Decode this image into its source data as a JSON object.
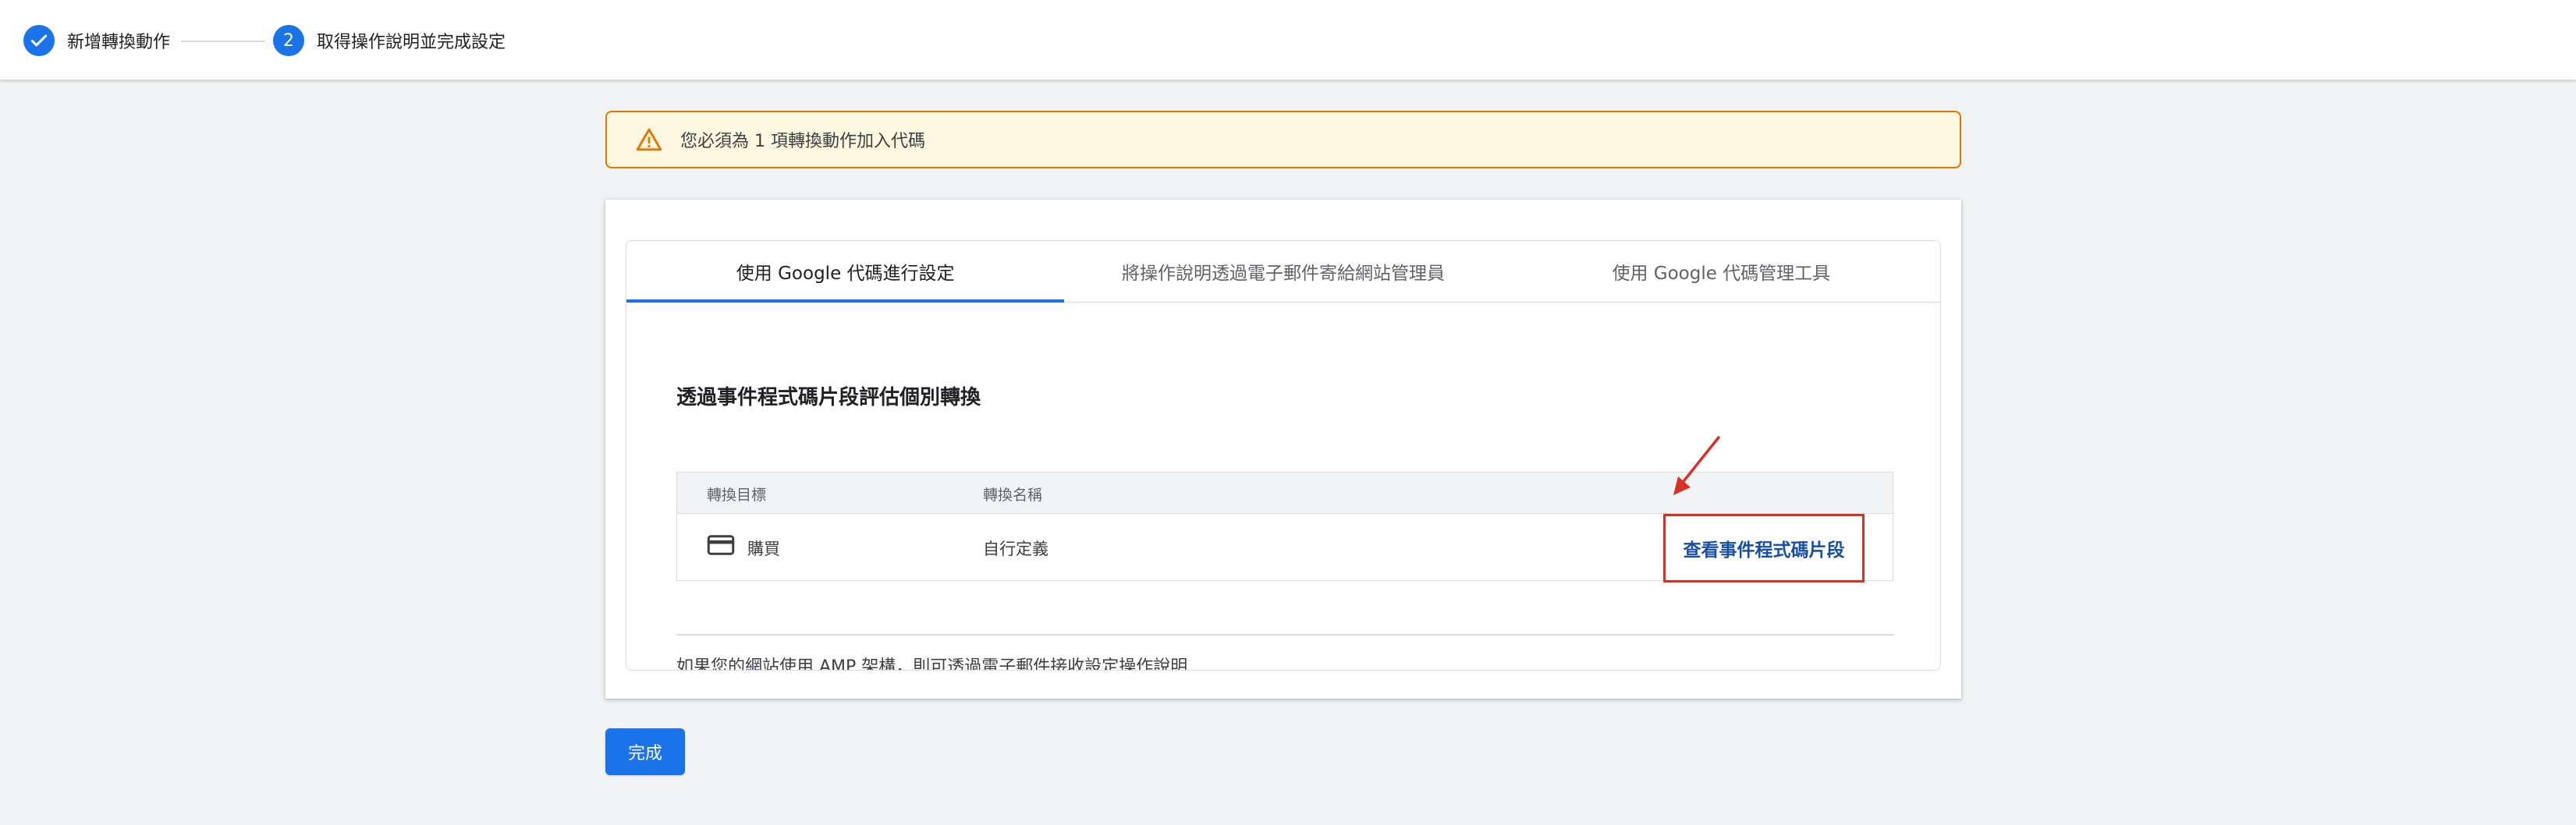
{
  "stepper": {
    "steps": [
      {
        "label": "新增轉換動作",
        "status": "done"
      },
      {
        "label": "取得操作說明並完成設定",
        "number": "2",
        "status": "current"
      }
    ]
  },
  "alert": {
    "icon": "warning-icon",
    "text": "您必須為 1 項轉換動作加入代碼"
  },
  "tabs": [
    {
      "label": "使用 Google 代碼進行設定",
      "active": true
    },
    {
      "label": "將操作說明透過電子郵件寄給網站管理員",
      "active": false
    },
    {
      "label": "使用 Google 代碼管理工具",
      "active": false
    }
  ],
  "section": {
    "title": "透過事件程式碼片段評估個別轉換",
    "table": {
      "columns": [
        "轉換目標",
        "轉換名稱"
      ],
      "rows": [
        {
          "icon": "credit-card-icon",
          "goal": "購買",
          "name": "自行定義",
          "action": "查看事件程式碼片段"
        }
      ]
    },
    "amp_note": "如果您的網站使用 AMP 架構，則可透過電子郵件接收設定操作說明"
  },
  "footer": {
    "done_label": "完成"
  },
  "colors": {
    "accent": "#1a73e8",
    "warning": "#e37400",
    "highlight": "#d93025"
  }
}
